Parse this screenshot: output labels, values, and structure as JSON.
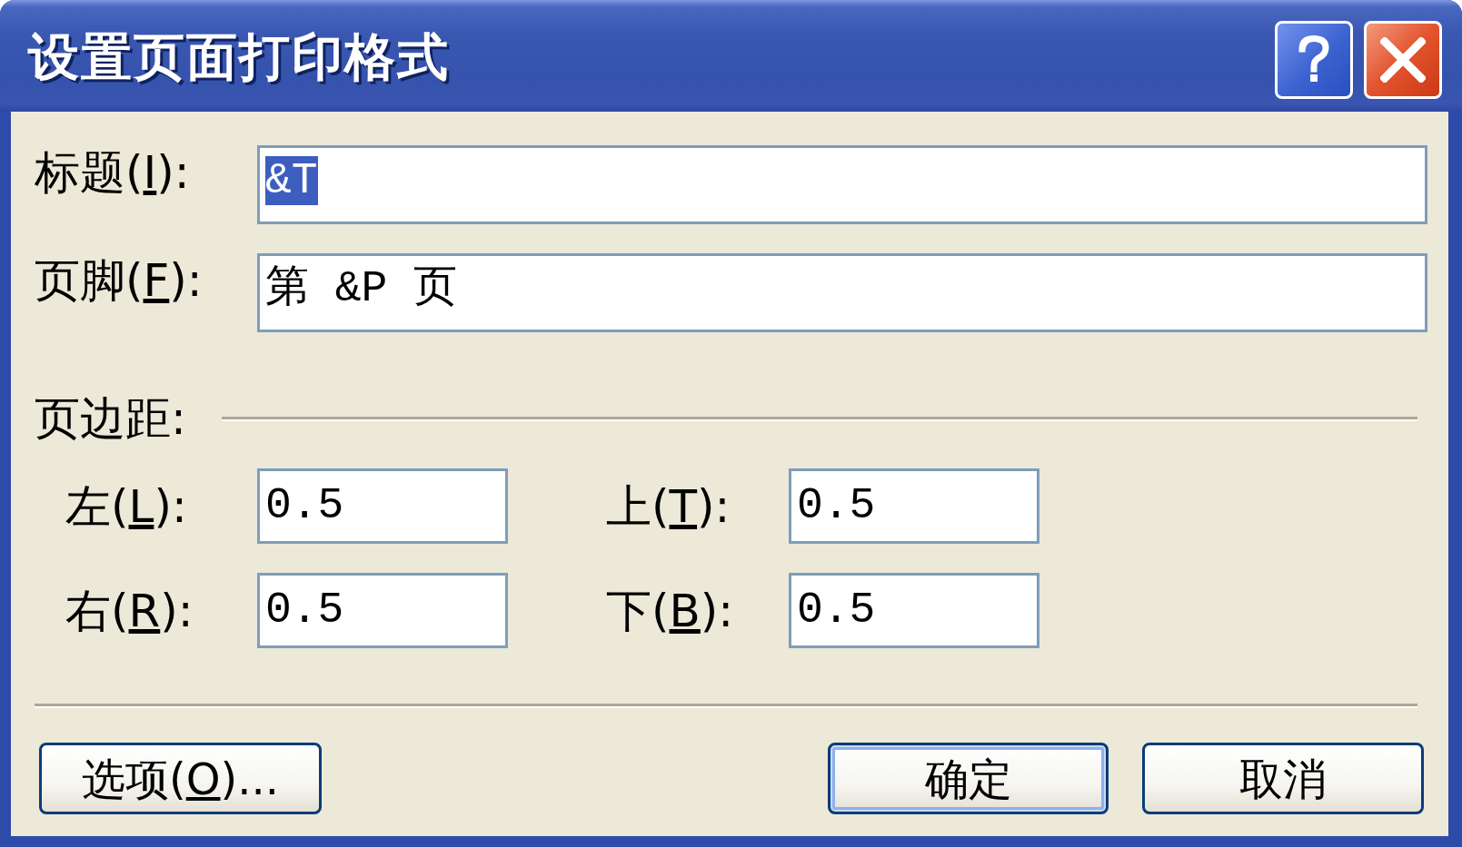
{
  "window": {
    "title": "设置页面打印格式"
  },
  "fields": [
    {
      "label": {
        "prefix": "标题(",
        "access_key": "I",
        "suffix": "):"
      },
      "value": "&T",
      "selected": true
    },
    {
      "label": {
        "prefix": "页脚(",
        "access_key": "F",
        "suffix": "):"
      },
      "value": "第 &P 页",
      "selected": false
    }
  ],
  "margins": {
    "label": "页边距:",
    "fields": [
      {
        "label": {
          "prefix": "左(",
          "access_key": "L",
          "suffix": "):"
        },
        "value": "0.5"
      },
      {
        "label": {
          "prefix": "上(",
          "access_key": "T",
          "suffix": "):"
        },
        "value": "0.5"
      },
      {
        "label": {
          "prefix": "右(",
          "access_key": "R",
          "suffix": "):"
        },
        "value": "0.5"
      },
      {
        "label": {
          "prefix": "下(",
          "access_key": "B",
          "suffix": "):"
        },
        "value": "0.5"
      }
    ]
  },
  "buttons": [
    {
      "label": {
        "prefix": "选项(",
        "access_key": "O",
        "suffix": ")..."
      },
      "default": false
    },
    {
      "label": {
        "prefix": "确定"
      },
      "default": true
    },
    {
      "label": {
        "prefix": "取消"
      },
      "default": false
    }
  ]
}
